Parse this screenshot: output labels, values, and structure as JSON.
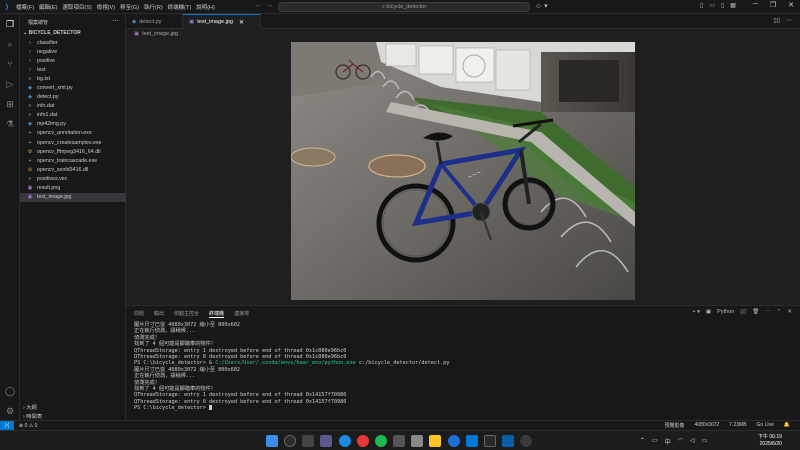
{
  "titlebar": {
    "menu": [
      "檔案(F)",
      "編輯(E)",
      "選取項目(S)",
      "檢視(V)",
      "移至(G)",
      "執行(R)",
      "終端機(T)",
      "說明(H)"
    ],
    "search_text": "bicycle_detector"
  },
  "sidebar": {
    "header": "檔案總管",
    "project": "BICYCLE_DETECTOR",
    "items": [
      {
        "label": "classifier",
        "icon": "chevron-right-icon",
        "kind": "folder"
      },
      {
        "label": "negative",
        "icon": "chevron-right-icon",
        "kind": "folder"
      },
      {
        "label": "positive",
        "icon": "chevron-right-icon",
        "kind": "folder"
      },
      {
        "label": "test",
        "icon": "chevron-right-icon",
        "kind": "folder"
      },
      {
        "label": "bg.txt",
        "icon": "text-file-icon",
        "kind": "txt"
      },
      {
        "label": "convert_xml.py",
        "icon": "python-file-icon",
        "kind": "py"
      },
      {
        "label": "detect.py",
        "icon": "python-file-icon",
        "kind": "py"
      },
      {
        "label": "info.dat",
        "icon": "text-file-icon",
        "kind": "txt"
      },
      {
        "label": "info1.dat",
        "icon": "text-file-icon",
        "kind": "txt"
      },
      {
        "label": "mp42img.py",
        "icon": "python-file-icon",
        "kind": "py"
      },
      {
        "label": "opencv_annotation.exe",
        "icon": "exe-file-icon",
        "kind": "exe"
      },
      {
        "label": "opencv_createsamples.exe",
        "icon": "exe-file-icon",
        "kind": "exe"
      },
      {
        "label": "opencv_ffmpeg3416_64.dll",
        "icon": "dll-file-icon",
        "kind": "dll"
      },
      {
        "label": "opencv_traincascade.exe",
        "icon": "exe-file-icon",
        "kind": "exe"
      },
      {
        "label": "opencv_world3416.dll",
        "icon": "dll-file-icon",
        "kind": "dll"
      },
      {
        "label": "positives.vec",
        "icon": "text-file-icon",
        "kind": "vec"
      },
      {
        "label": "result.png",
        "icon": "image-file-icon",
        "kind": "img"
      },
      {
        "label": "test_image.jpg",
        "icon": "image-file-icon",
        "kind": "img",
        "selected": true
      }
    ],
    "outline": "大綱",
    "timeline": "時間表"
  },
  "tabs": [
    {
      "label": "detect.py",
      "icon": "python-file-icon",
      "active": false
    },
    {
      "label": "test_image.jpg",
      "icon": "image-file-icon",
      "active": true
    }
  ],
  "breadcrumb": "test_image.jpg",
  "panel": {
    "tabs": [
      "問題",
      "輸出",
      "偵錯主控台",
      "終端機",
      "連接埠"
    ],
    "active_tab": "終端機",
    "shell": "Python",
    "terminal_lines": [
      {
        "text": "圖片尺寸已從 4080x3072 縮小至 800x602"
      },
      {
        "text": "正在執行偵測，請稍候..."
      },
      {
        "text": "偵測完成！"
      },
      {
        "text": "找到了 4 個可能是腳踏車的物件！"
      },
      {
        "text": "QThreadStorage: entry 1 destroyed before end of thread 0x1c080e96bc0"
      },
      {
        "text": "QThreadStorage: entry 0 destroyed before end of thread 0x1c080e96bc0"
      },
      {
        "prompt": "PS C:\\bicycle_detector> & ",
        "cmd": "C:/Users/User/.conda/envs/haar_env/python.exe",
        "arg": " c:/bicycle_detector/detect.py"
      },
      {
        "text": "圖片尺寸已從 4080x3072 縮小至 800x602"
      },
      {
        "text": "正在執行偵測，請稍候..."
      },
      {
        "text": "偵測完成！"
      },
      {
        "text": "找到了 4 個可能是腳踏車的物件！"
      },
      {
        "text": "QThreadStorage: entry 1 destroyed before end of thread 0x14157f70980"
      },
      {
        "text": "QThreadStorage: entry 0 destroyed before end of thread 0x14157f70980"
      },
      {
        "prompt": "PS C:\\bicycle_detector> ",
        "cursor": true
      }
    ]
  },
  "statusbar": {
    "problems": "⊗ 0 ⚠ 0",
    "right": [
      "預覽影像",
      "4080x3072",
      "7.23MB",
      "Go Live"
    ]
  },
  "taskbar": {
    "time": "下午 06:19",
    "date": "2025/6/20"
  },
  "colors": {
    "accent": "#0078d4",
    "terminal_path": "#23d18b"
  }
}
